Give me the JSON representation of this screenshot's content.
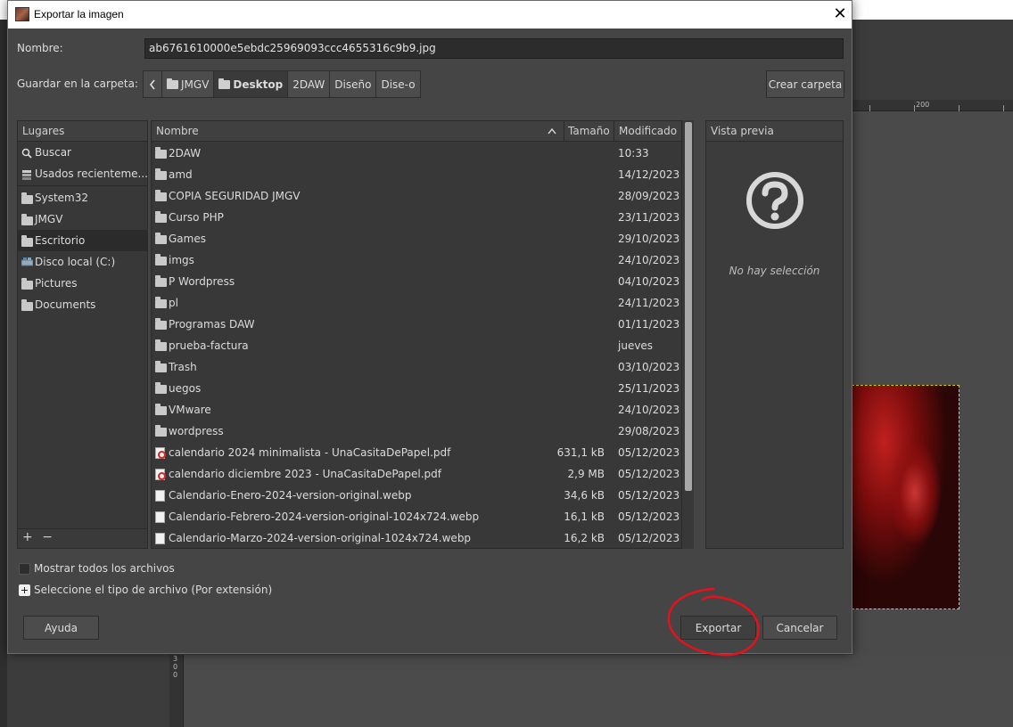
{
  "dialog": {
    "title": "Exportar la imagen",
    "name_label": "Nombre:",
    "name_value": "ab6761610000e5ebdc25969093ccc4655316c9b9.jpg",
    "folder_label": "Guardar en la carpeta:",
    "create_folder": "Crear carpeta"
  },
  "pathbar": [
    "JMGV",
    "Desktop",
    "2DAW",
    "Diseño",
    "Dise-o"
  ],
  "places": {
    "header": "Lugares",
    "items": [
      {
        "label": "Buscar",
        "icon": "search-icon"
      },
      {
        "label": "Usados recienteme...",
        "icon": "recent-icon"
      },
      {
        "label": "System32",
        "icon": "folder-icon"
      },
      {
        "label": "JMGV",
        "icon": "folder-icon"
      },
      {
        "label": "Escritorio",
        "icon": "folder-icon"
      },
      {
        "label": "Disco local (C:)",
        "icon": "drive-icon"
      },
      {
        "label": "Pictures",
        "icon": "folder-icon"
      },
      {
        "label": "Documents",
        "icon": "folder-icon"
      }
    ],
    "add_symbol": "+",
    "remove_symbol": "−"
  },
  "file_list": {
    "columns": {
      "name": "Nombre",
      "size": "Tamaño",
      "modified": "Modificado"
    },
    "rows": [
      {
        "type": "folder",
        "name": "2DAW",
        "size": "",
        "modified": "10:33"
      },
      {
        "type": "folder",
        "name": "amd",
        "size": "",
        "modified": "14/12/2023"
      },
      {
        "type": "folder",
        "name": "COPIA SEGURIDAD JMGV",
        "size": "",
        "modified": "28/09/2023"
      },
      {
        "type": "folder",
        "name": "Curso PHP",
        "size": "",
        "modified": "23/11/2023"
      },
      {
        "type": "folder",
        "name": "Games",
        "size": "",
        "modified": "29/10/2023"
      },
      {
        "type": "folder",
        "name": "imgs",
        "size": "",
        "modified": "24/10/2023"
      },
      {
        "type": "folder",
        "name": "P Wordpress",
        "size": "",
        "modified": "04/10/2023"
      },
      {
        "type": "folder",
        "name": "pl",
        "size": "",
        "modified": "24/11/2023"
      },
      {
        "type": "folder",
        "name": "Programas DAW",
        "size": "",
        "modified": "01/11/2023"
      },
      {
        "type": "folder",
        "name": "prueba-factura",
        "size": "",
        "modified": "jueves"
      },
      {
        "type": "folder",
        "name": "Trash",
        "size": "",
        "modified": "03/10/2023"
      },
      {
        "type": "folder",
        "name": "uegos",
        "size": "",
        "modified": "25/11/2023"
      },
      {
        "type": "folder",
        "name": "VMware",
        "size": "",
        "modified": "24/10/2023"
      },
      {
        "type": "folder",
        "name": "wordpress",
        "size": "",
        "modified": "29/08/2023"
      },
      {
        "type": "pdf",
        "name": "calendario 2024 minimalista - UnaCasitaDePapel.pdf",
        "size": "631,1 kB",
        "modified": "05/12/2023"
      },
      {
        "type": "pdf",
        "name": "calendario diciembre 2023 - UnaCasitaDePapel.pdf",
        "size": "2,9 MB",
        "modified": "05/12/2023"
      },
      {
        "type": "file",
        "name": "Calendario-Enero-2024-version-original.webp",
        "size": "34,6 kB",
        "modified": "05/12/2023"
      },
      {
        "type": "file",
        "name": "Calendario-Febrero-2024-version-original-1024x724.webp",
        "size": "16,1 kB",
        "modified": "05/12/2023"
      },
      {
        "type": "file",
        "name": "Calendario-Marzo-2024-version-original-1024x724.webp",
        "size": "16,2 kB",
        "modified": "05/12/2023"
      }
    ]
  },
  "preview": {
    "header": "Vista previa",
    "empty_text": "No hay selección"
  },
  "options": {
    "show_all": "Mostrar todos los archivos",
    "file_type": "Seleccione el tipo de archivo (Por extensión)"
  },
  "buttons": {
    "help": "Ayuda",
    "export": "Exportar",
    "cancel": "Cancelar"
  },
  "background": {
    "ruler_label": "200",
    "vruler_digits": "3\n0\n0"
  },
  "colors": {
    "annotation": "#e8101a",
    "dialog_bg": "#454545"
  }
}
